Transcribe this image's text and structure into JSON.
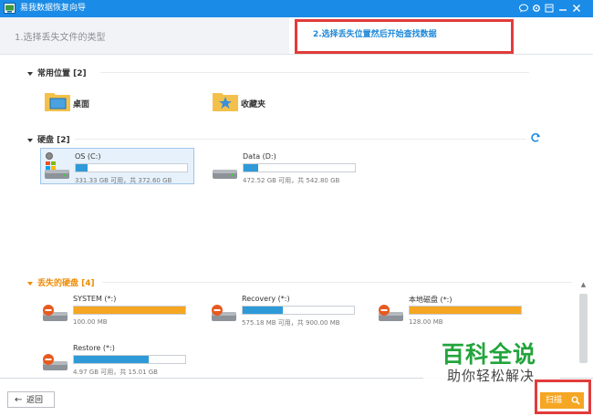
{
  "window": {
    "title": "易我数据恢复向导",
    "buttons": [
      "chat-icon",
      "settings-icon",
      "restore-icon",
      "minimize-icon",
      "close-icon"
    ]
  },
  "steps": {
    "step1": "1.选择丢失文件的类型",
    "step2": "2.选择丢失位置然后开始查找数据"
  },
  "common_locations": {
    "heading": "常用位置 [2]",
    "items": [
      {
        "label": "桌面",
        "icon": "desktop-folder-icon"
      },
      {
        "label": "收藏夹",
        "icon": "favorites-folder-icon"
      }
    ]
  },
  "hard_disks": {
    "heading": "硬盘 [2]",
    "drives": [
      {
        "name": "OS (C:)",
        "info": "331.33 GB 可用，共 372.60 GB",
        "used_fraction": 0.11,
        "color": "#2e9ad8",
        "selected": true
      },
      {
        "name": "Data (D:)",
        "info": "472.52 GB 可用，共 542.80 GB",
        "used_fraction": 0.13,
        "color": "#2e9ad8",
        "selected": false
      }
    ]
  },
  "lost_disks": {
    "heading": "丢失的硬盘 [4]",
    "drives": [
      {
        "name": "SYSTEM (*:)",
        "info": "100.00 MB",
        "used_fraction": 1.0,
        "color": "#f5a623"
      },
      {
        "name": "Recovery (*:)",
        "info": "575.18 MB 可用，共 900.00 MB",
        "used_fraction": 0.36,
        "color": "#2e9ad8"
      },
      {
        "name": "本地磁盘 (*:)",
        "info": "128.00 MB",
        "used_fraction": 1.0,
        "color": "#f5a623"
      },
      {
        "name": "Restore (*:)",
        "info": "4.97 GB 可用，共 15.01 GB",
        "used_fraction": 0.67,
        "color": "#2e9ad8"
      }
    ]
  },
  "footer": {
    "back_label": "返回",
    "scan_label": "扫描"
  },
  "watermark": {
    "big": "百科全说",
    "small": "助你轻松解决"
  }
}
